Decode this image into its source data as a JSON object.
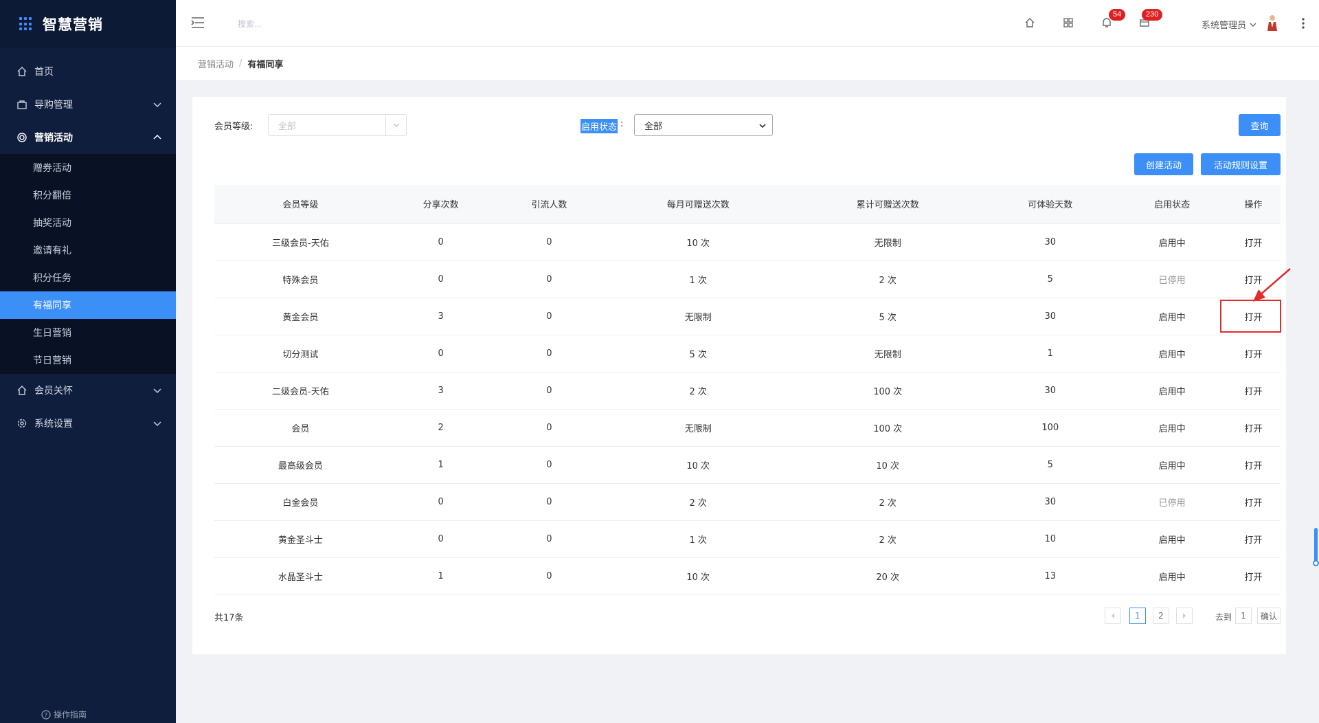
{
  "app": {
    "title": "智慧营销"
  },
  "sidebar": {
    "items": [
      {
        "label": "首页",
        "icon": "home-icon"
      },
      {
        "label": "导购管理",
        "icon": "bag-icon"
      },
      {
        "label": "营销活动",
        "icon": "target-icon"
      },
      {
        "label": "会员关怀",
        "icon": "home-icon"
      },
      {
        "label": "系统设置",
        "icon": "gear-icon"
      }
    ],
    "sub_items": [
      {
        "label": "赠券活动"
      },
      {
        "label": "积分翻倍"
      },
      {
        "label": "抽奖活动"
      },
      {
        "label": "邀请有礼"
      },
      {
        "label": "积分任务"
      },
      {
        "label": "有福同享"
      },
      {
        "label": "生日营销"
      },
      {
        "label": "节日营销"
      }
    ],
    "guide": "操作指南"
  },
  "header": {
    "search_placeholder": "搜索...",
    "bell_count": "54",
    "mail_count": "230",
    "user_name": "系统管理员"
  },
  "breadcrumb": {
    "parent": "营销活动",
    "current": "有福同享"
  },
  "filters": {
    "level_label": "会员等级:",
    "level_placeholder": "全部",
    "status_label": "启用状态",
    "status_colon": ":",
    "status_value": "全部",
    "query_button": "查询",
    "create_button": "创建活动",
    "rules_button": "活动规则设置"
  },
  "table": {
    "headers": [
      "会员等级",
      "分享次数",
      "引流人数",
      "每月可赠送次数",
      "累计可赠送次数",
      "可体验天数",
      "启用状态",
      "操作"
    ],
    "rows": [
      [
        "三级会员-天佑",
        "0",
        "0",
        "10 次",
        "无限制",
        "30",
        "启用中",
        "打开"
      ],
      [
        "特殊会员",
        "0",
        "0",
        "1 次",
        "2 次",
        "5",
        "已停用",
        "打开"
      ],
      [
        "黄金会员",
        "3",
        "0",
        "无限制",
        "5 次",
        "30",
        "启用中",
        "打开"
      ],
      [
        "切分测试",
        "0",
        "0",
        "5 次",
        "无限制",
        "1",
        "启用中",
        "打开"
      ],
      [
        "二级会员-天佑",
        "3",
        "0",
        "2 次",
        "100 次",
        "30",
        "启用中",
        "打开"
      ],
      [
        "会员",
        "2",
        "0",
        "无限制",
        "100 次",
        "100",
        "启用中",
        "打开"
      ],
      [
        "最高级会员",
        "1",
        "0",
        "10 次",
        "10 次",
        "5",
        "启用中",
        "打开"
      ],
      [
        "白金会员",
        "0",
        "0",
        "2 次",
        "2 次",
        "30",
        "已停用",
        "打开"
      ],
      [
        "黄金圣斗士",
        "0",
        "0",
        "1 次",
        "2 次",
        "10",
        "启用中",
        "打开"
      ],
      [
        "水晶圣斗士",
        "1",
        "0",
        "10 次",
        "20 次",
        "13",
        "启用中",
        "打开"
      ]
    ]
  },
  "pagination": {
    "total": "共17条",
    "pages": [
      "1",
      "2"
    ],
    "goto_label": "去到",
    "goto_value": "1",
    "confirm": "确认"
  },
  "colors": {
    "accent": "#3b8ff6",
    "sidebar": "#0f1e3d",
    "highlight": "#e32b2b"
  }
}
